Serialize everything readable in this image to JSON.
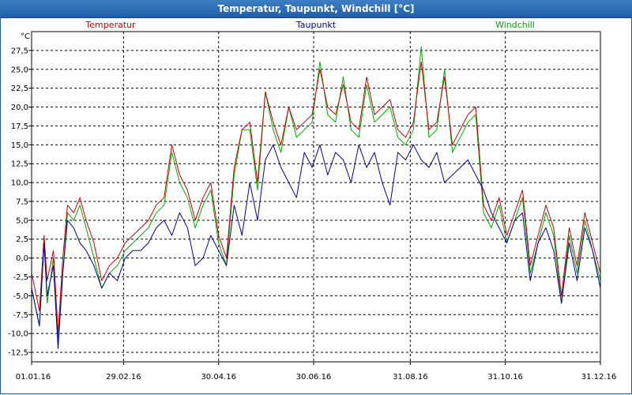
{
  "window": {
    "title": "Temperatur, Taupunkt, Windchill [°C]"
  },
  "chart_data": {
    "type": "line",
    "title": "Temperatur, Taupunkt, Windchill [°C]",
    "ylabel": "°C",
    "ylim": [
      -13.75,
      30
    ],
    "y_ticks": [
      -12.5,
      -10,
      -7.5,
      -5,
      -2.5,
      0,
      2.5,
      5,
      7.5,
      10,
      12.5,
      15,
      17.5,
      20,
      22.5,
      25,
      27.5
    ],
    "y_tick_labels": [
      "-12,5",
      "-10,0",
      "-7,5",
      "-5,0",
      "-2,5",
      "0,0",
      "2,5",
      "5,0",
      "7,5",
      "10,0",
      "12,5",
      "15,0",
      "17,5",
      "20,0",
      "22,5",
      "25,0",
      "27,5"
    ],
    "x_tick_labels": [
      "01.01.16",
      "29.02.16",
      "30.04.16",
      "30.06.16",
      "31.08.16",
      "31.10.16",
      "31.12.16"
    ],
    "x_tick_days": [
      0,
      59,
      120,
      181,
      243,
      304,
      365
    ],
    "x_range": [
      0,
      365
    ],
    "grid": true,
    "legend_position": "top",
    "series": [
      {
        "name": "Temperatur",
        "color": "#cc0000",
        "x": [
          0,
          5,
          8,
          10,
          14,
          17,
          20,
          23,
          27,
          31,
          35,
          40,
          45,
          50,
          55,
          60,
          65,
          70,
          75,
          80,
          85,
          90,
          95,
          100,
          105,
          110,
          115,
          120,
          125,
          130,
          135,
          140,
          145,
          150,
          155,
          160,
          165,
          170,
          175,
          180,
          185,
          190,
          195,
          200,
          205,
          210,
          215,
          220,
          225,
          230,
          235,
          240,
          245,
          250,
          255,
          260,
          265,
          270,
          275,
          280,
          285,
          290,
          295,
          300,
          305,
          310,
          315,
          320,
          325,
          330,
          335,
          340,
          345,
          350,
          355,
          360,
          365
        ],
        "values": [
          -2,
          -7,
          3,
          -3,
          1,
          -10,
          0,
          7,
          6,
          8,
          5,
          2,
          -3,
          -1,
          0,
          2,
          3,
          4,
          5,
          7,
          8,
          15,
          11,
          9,
          5,
          8,
          10,
          3,
          0,
          12,
          17,
          18,
          10,
          22,
          18,
          15,
          20,
          17,
          18,
          19,
          25,
          20,
          19,
          23,
          18,
          17,
          24,
          19,
          20,
          21,
          17,
          16,
          18,
          26,
          17,
          18,
          24,
          15,
          17,
          19,
          20,
          7,
          5,
          8,
          3,
          6,
          9,
          -1,
          3,
          7,
          4,
          -5,
          4,
          -1,
          6,
          2,
          -2
        ]
      },
      {
        "name": "Taupunkt",
        "color": "#000099",
        "x": [
          0,
          5,
          8,
          10,
          14,
          17,
          20,
          23,
          27,
          31,
          35,
          40,
          45,
          50,
          55,
          60,
          65,
          70,
          75,
          80,
          85,
          90,
          95,
          100,
          105,
          110,
          115,
          120,
          125,
          130,
          135,
          140,
          145,
          150,
          155,
          160,
          165,
          170,
          175,
          180,
          185,
          190,
          195,
          200,
          205,
          210,
          215,
          220,
          225,
          230,
          235,
          240,
          245,
          250,
          255,
          260,
          265,
          270,
          275,
          280,
          285,
          290,
          295,
          300,
          305,
          310,
          315,
          320,
          325,
          330,
          335,
          340,
          345,
          350,
          355,
          360,
          365
        ],
        "values": [
          -4,
          -9,
          2,
          -5,
          -1,
          -12,
          -2,
          5,
          4,
          2,
          1,
          -1,
          -4,
          -2,
          -3,
          0,
          1,
          1,
          2,
          4,
          5,
          3,
          6,
          4,
          -1,
          0,
          3,
          1,
          -1,
          7,
          3,
          10,
          5,
          13,
          15,
          12,
          10,
          8,
          14,
          12,
          15,
          11,
          14,
          13,
          10,
          15,
          12,
          14,
          10,
          7,
          14,
          13,
          15,
          13,
          12,
          14,
          10,
          11,
          12,
          13,
          11,
          9,
          6,
          4,
          2,
          5,
          6,
          -3,
          2,
          4,
          1,
          -6,
          2,
          -3,
          4,
          1,
          -4
        ]
      },
      {
        "name": "Windchill",
        "color": "#00aa00",
        "x": [
          0,
          5,
          8,
          10,
          14,
          17,
          20,
          23,
          27,
          31,
          35,
          40,
          45,
          50,
          55,
          60,
          65,
          70,
          75,
          80,
          85,
          90,
          95,
          100,
          105,
          110,
          115,
          120,
          125,
          130,
          135,
          140,
          145,
          150,
          155,
          160,
          165,
          170,
          175,
          180,
          185,
          190,
          195,
          200,
          205,
          210,
          215,
          220,
          225,
          230,
          235,
          240,
          245,
          250,
          255,
          260,
          265,
          270,
          275,
          280,
          285,
          290,
          295,
          300,
          305,
          310,
          315,
          320,
          325,
          330,
          335,
          340,
          345,
          350,
          355,
          360,
          365
        ],
        "values": [
          -4,
          -9,
          2,
          -6,
          0,
          -11,
          -2,
          6,
          5,
          7,
          4,
          0,
          -4,
          -2,
          -1,
          1,
          2,
          3,
          4,
          6,
          7,
          14,
          10,
          8,
          4,
          7,
          9,
          2,
          -1,
          11,
          17,
          17,
          9,
          22,
          17,
          14,
          20,
          16,
          17,
          18,
          26,
          19,
          18,
          24,
          17,
          16,
          23,
          18,
          19,
          20,
          16,
          15,
          17,
          28,
          16,
          17,
          25,
          14,
          16,
          18,
          19,
          6,
          4,
          7,
          2,
          5,
          8,
          -2,
          2,
          6,
          3,
          -6,
          3,
          -2,
          5,
          1,
          -3
        ]
      }
    ]
  }
}
